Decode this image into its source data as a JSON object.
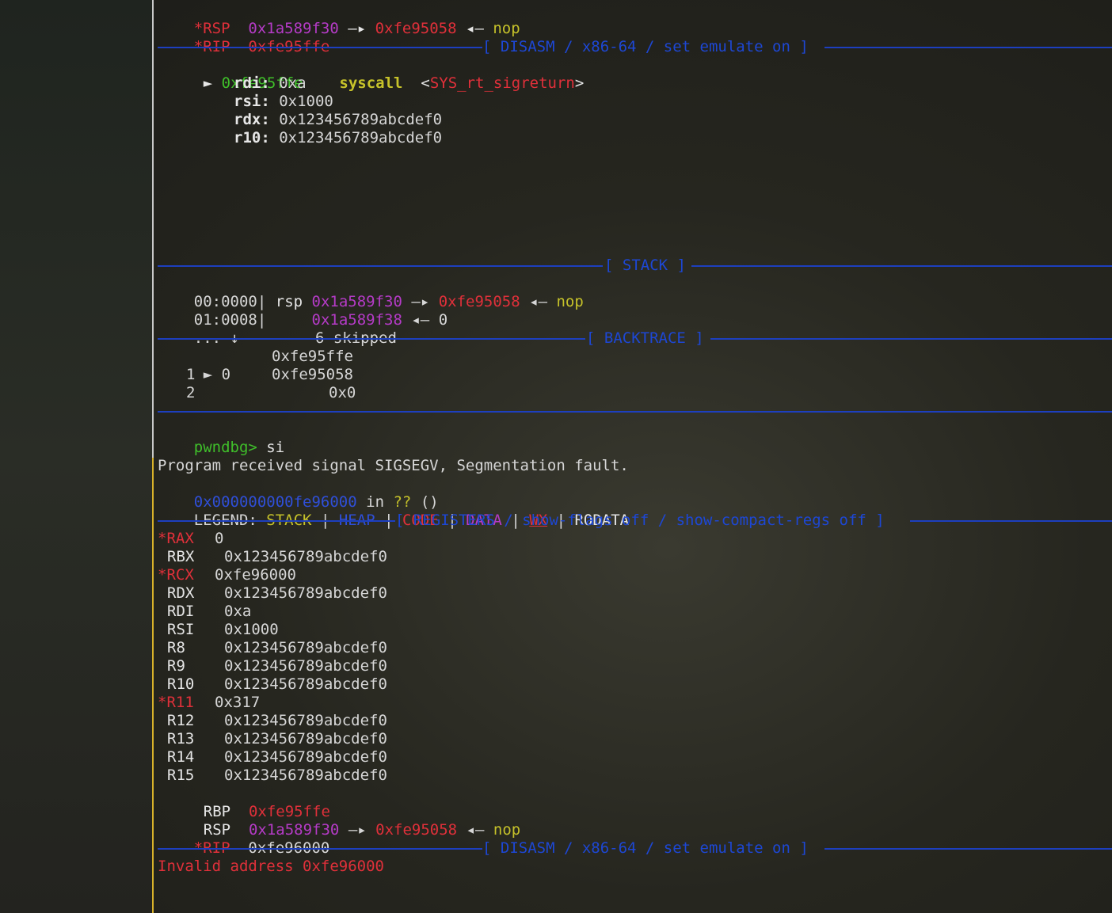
{
  "top_regs": [
    {
      "name": "*RSP",
      "addr": "0x1a589f30",
      "arrow1": "—▸",
      "ptr": "0xfe95058",
      "arrow2": "◂—",
      "val": "nop"
    },
    {
      "name": "*RIP",
      "addr": "0xfe95ffe"
    }
  ],
  "disasm_header": "[ DISASM / x86-64 / set emulate on ]",
  "disasm": {
    "marker": "►",
    "addr": "0xfe95ffe",
    "instr": "syscall",
    "target_open": "<",
    "target": "SYS_rt_sigreturn",
    "target_close": ">",
    "args": [
      {
        "name": "rdi:",
        "value": "0xa"
      },
      {
        "name": "rsi:",
        "value": "0x1000"
      },
      {
        "name": "rdx:",
        "value": "0x123456789abcdef0"
      },
      {
        "name": "r10:",
        "value": "0x123456789abcdef0"
      }
    ]
  },
  "stack_header": "[ STACK ]",
  "stack": [
    {
      "offset": "00:0000",
      "bar": "|",
      "reg": "rsp",
      "addr": "0x1a589f30",
      "arrow1": "—▸",
      "ptr": "0xfe95058",
      "arrow2": "◂—",
      "val": "nop"
    },
    {
      "offset": "01:0008",
      "bar": "|",
      "reg": "",
      "addr": "0x1a589f38",
      "arrow1": "◂—",
      "ptr": "0"
    },
    {
      "offset": "... ↓",
      "bar": "",
      "reg": "",
      "skipped": "6 skipped"
    }
  ],
  "backtrace_header": "[ BACKTRACE ]",
  "backtrace": [
    {
      "marker": "►",
      "index": "0",
      "addr": "0xfe95ffe"
    },
    {
      "marker": "",
      "index": "1",
      "addr": "0xfe95058"
    },
    {
      "marker": "",
      "index": "2",
      "addr": "0x0"
    }
  ],
  "prompt": {
    "label": "pwndbg>",
    "command": "si"
  },
  "signal_msg": "Program received signal SIGSEGV, Segmentation fault.",
  "fault_location": {
    "addr": "0x000000000fe96000",
    "in": "in",
    "func": "??",
    "parens": "()"
  },
  "legend": {
    "label": "LEGEND:",
    "sep": "|",
    "items": [
      "STACK",
      "HEAP",
      "CODE",
      "DATA",
      "WX",
      "RODATA"
    ]
  },
  "registers_header": "[ REGISTERS / show-flags off / show-compact-regs off ]",
  "registers": [
    {
      "name": "*RAX",
      "value": "0",
      "changed": true
    },
    {
      "name": "RBX",
      "value": "0x123456789abcdef0",
      "changed": false
    },
    {
      "name": "*RCX",
      "value": "0xfe96000",
      "changed": true
    },
    {
      "name": "RDX",
      "value": "0x123456789abcdef0",
      "changed": false
    },
    {
      "name": "RDI",
      "value": "0xa",
      "changed": false
    },
    {
      "name": "RSI",
      "value": "0x1000",
      "changed": false
    },
    {
      "name": "R8",
      "value": "0x123456789abcdef0",
      "changed": false
    },
    {
      "name": "R9",
      "value": "0x123456789abcdef0",
      "changed": false
    },
    {
      "name": "R10",
      "value": "0x123456789abcdef0",
      "changed": false
    },
    {
      "name": "*R11",
      "value": "0x317",
      "changed": true
    },
    {
      "name": "R12",
      "value": "0x123456789abcdef0",
      "changed": false
    },
    {
      "name": "R13",
      "value": "0x123456789abcdef0",
      "changed": false
    },
    {
      "name": "R14",
      "value": "0x123456789abcdef0",
      "changed": false
    },
    {
      "name": "R15",
      "value": "0x123456789abcdef0",
      "changed": false
    }
  ],
  "rbp": {
    "name": "RBP",
    "value": "0xfe95ffe"
  },
  "rsp": {
    "name": "RSP",
    "addr": "0x1a589f30",
    "arrow1": "—▸",
    "ptr": "0xfe95058",
    "arrow2": "◂—",
    "val": "nop"
  },
  "rip": {
    "name": "*RIP",
    "value": "0xfe96000"
  },
  "disasm2_header": "[ DISASM / x86-64 / set emulate on ]",
  "invalid_msg": "Invalid address 0xfe96000",
  "colors": {
    "red": "#e0303a",
    "purple": "#b53bc7",
    "green": "#3fbf2a",
    "yellow": "#c6c22a",
    "blue": "#2f4fd8",
    "separator": "#1d3fbf"
  }
}
